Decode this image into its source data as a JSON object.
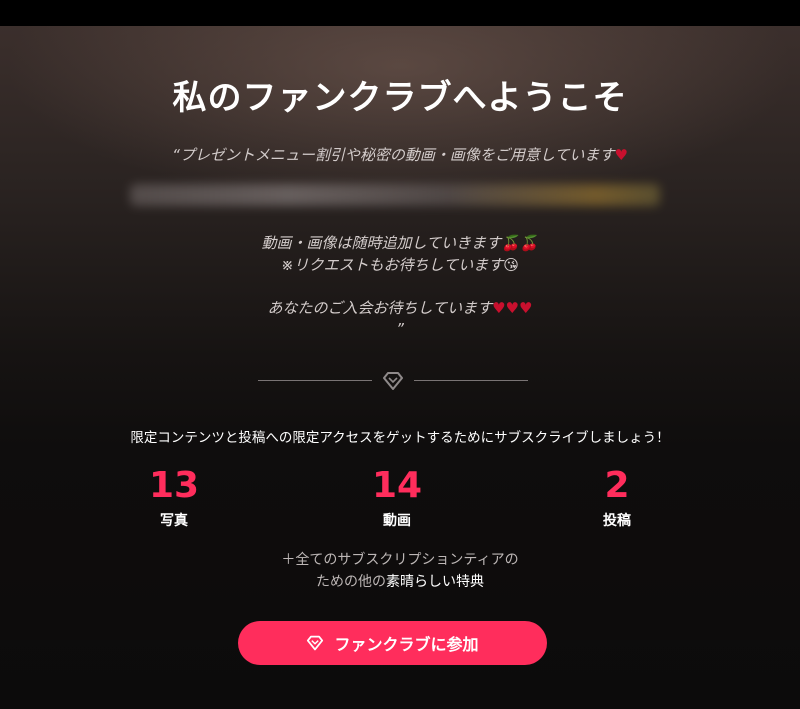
{
  "header": {
    "title": "私のファンクラブへようこそ"
  },
  "description": {
    "line1": "“プレゼントメニュー割引や秘密の動画・画像をご用意しています",
    "line3": "動画・画像は随時追加していきます🍒🍒",
    "line4": "※リクエストもお待ちしています😘",
    "line5": "あなたのご入会お待ちしています",
    "line6": "”",
    "heart": "♥"
  },
  "subscribe": {
    "prompt": "限定コンテンツと投稿への限定アクセスをゲットするためにサブスクライブしましょう！"
  },
  "stats": [
    {
      "value": "13",
      "label": "写真"
    },
    {
      "value": "14",
      "label": "動画"
    },
    {
      "value": "2",
      "label": "投稿"
    }
  ],
  "perks": {
    "line1": "＋全てのサブスクリプションティアの",
    "line2_prefix": "ための他の",
    "line2_highlight": "素晴らしい特典"
  },
  "join_button": {
    "label": "ファンクラブに参加",
    "icon": "diamond-icon"
  },
  "colors": {
    "accent": "#ff2d5c",
    "heart": "#c8102e"
  }
}
